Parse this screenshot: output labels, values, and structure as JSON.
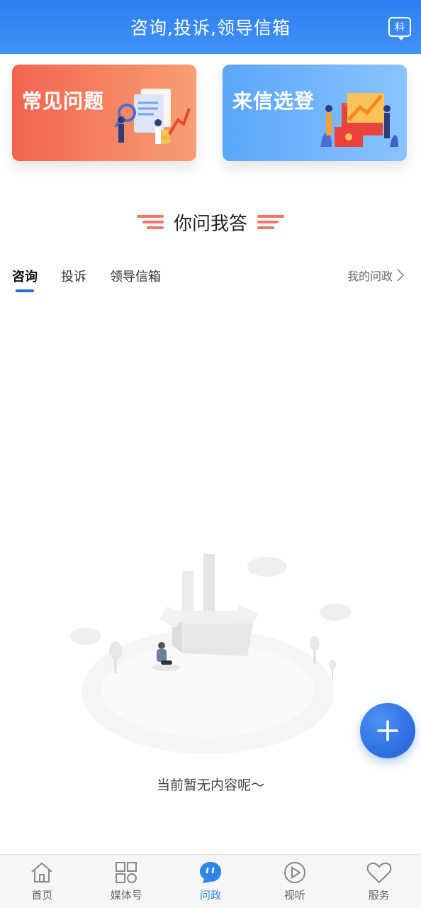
{
  "header": {
    "title": "咨询,投诉,领导信箱",
    "tip_label": "料"
  },
  "cards": {
    "faq": {
      "label": "常见问题"
    },
    "letters": {
      "label": "来信选登"
    }
  },
  "section": {
    "title": "你问我答"
  },
  "tabs": {
    "items": [
      {
        "label": "咨询",
        "active": true
      },
      {
        "label": "投诉",
        "active": false
      },
      {
        "label": "领导信箱",
        "active": false
      }
    ],
    "my_link": "我的问政"
  },
  "empty": {
    "message": "当前暂无内容呢～"
  },
  "fab": {
    "icon": "plus-icon"
  },
  "tabbar": {
    "items": [
      {
        "label": "首页",
        "icon": "home-icon"
      },
      {
        "label": "媒体号",
        "icon": "grid-icon"
      },
      {
        "label": "问政",
        "icon": "chat-bubble-icon",
        "active": true
      },
      {
        "label": "视听",
        "icon": "play-icon"
      },
      {
        "label": "服务",
        "icon": "heart-icon"
      }
    ]
  },
  "colors": {
    "header": "#2f7df0",
    "accent_blue": "#2c68d6",
    "card_orange": "#f3644e",
    "card_blue": "#5aa6f9",
    "tab_active": "#2e86e8"
  }
}
